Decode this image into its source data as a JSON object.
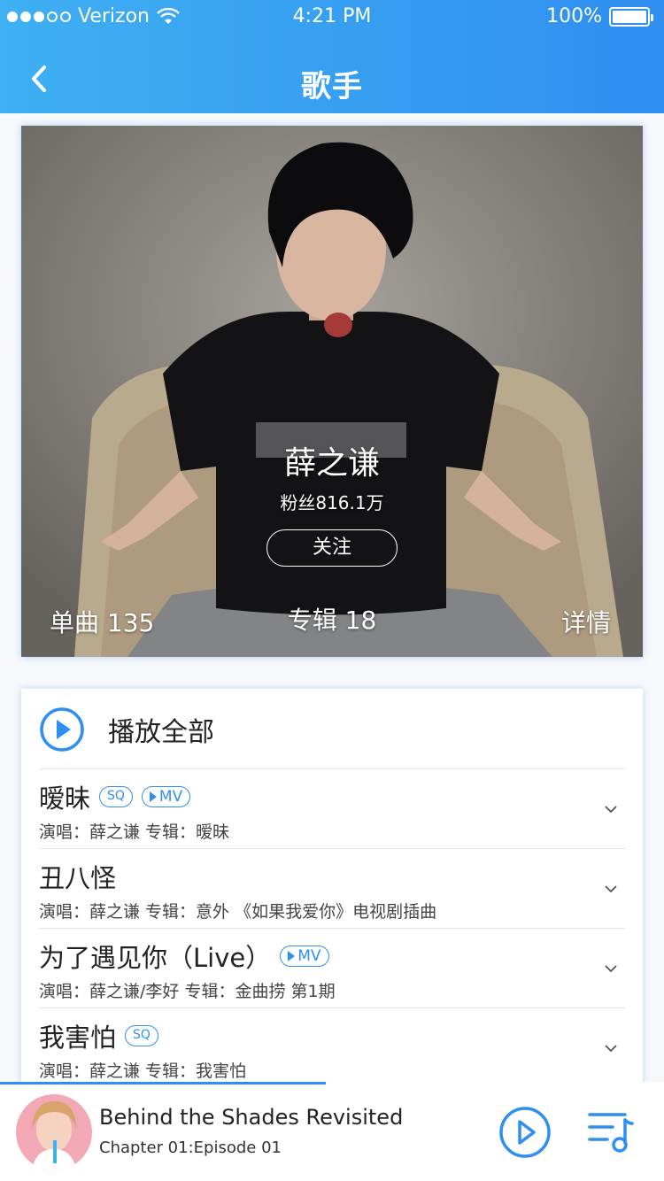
{
  "status_bar": {
    "carrier": "Verizon",
    "time": "4:21 PM",
    "battery": "100%"
  },
  "header": {
    "title": "歌手",
    "back_icon": "chevron-left-icon"
  },
  "colors": {
    "accent": "#2f8ff0",
    "header_gradient_start": "#3fb0f3",
    "header_gradient_end": "#2f8ff0"
  },
  "singer": {
    "name": "薛之谦",
    "fans": "粉丝816.1万",
    "follow_label": "关注",
    "singles": "单曲 135",
    "albums": "专辑 18",
    "details": "详情"
  },
  "list": {
    "play_all": "播放全部",
    "songs": [
      {
        "title": "暧昧",
        "sq": "SQ",
        "mv": "MV",
        "sub": "演唱：薛之谦  专辑：暧昧"
      },
      {
        "title": "丑八怪",
        "sub": "演唱：薛之谦  专辑：意外  《如果我爱你》电视剧插曲"
      },
      {
        "title": "为了遇见你（Live）",
        "mv": "MV",
        "sub": "演唱：薛之谦/李好  专辑：金曲捞 第1期"
      },
      {
        "title": "我害怕",
        "sq": "SQ",
        "sub": "演唱：薛之谦  专辑：我害怕"
      }
    ]
  },
  "player": {
    "title": "Behind the Shades Revisited",
    "subtitle": "Chapter 01:Episode 01",
    "progress": 0.49
  }
}
